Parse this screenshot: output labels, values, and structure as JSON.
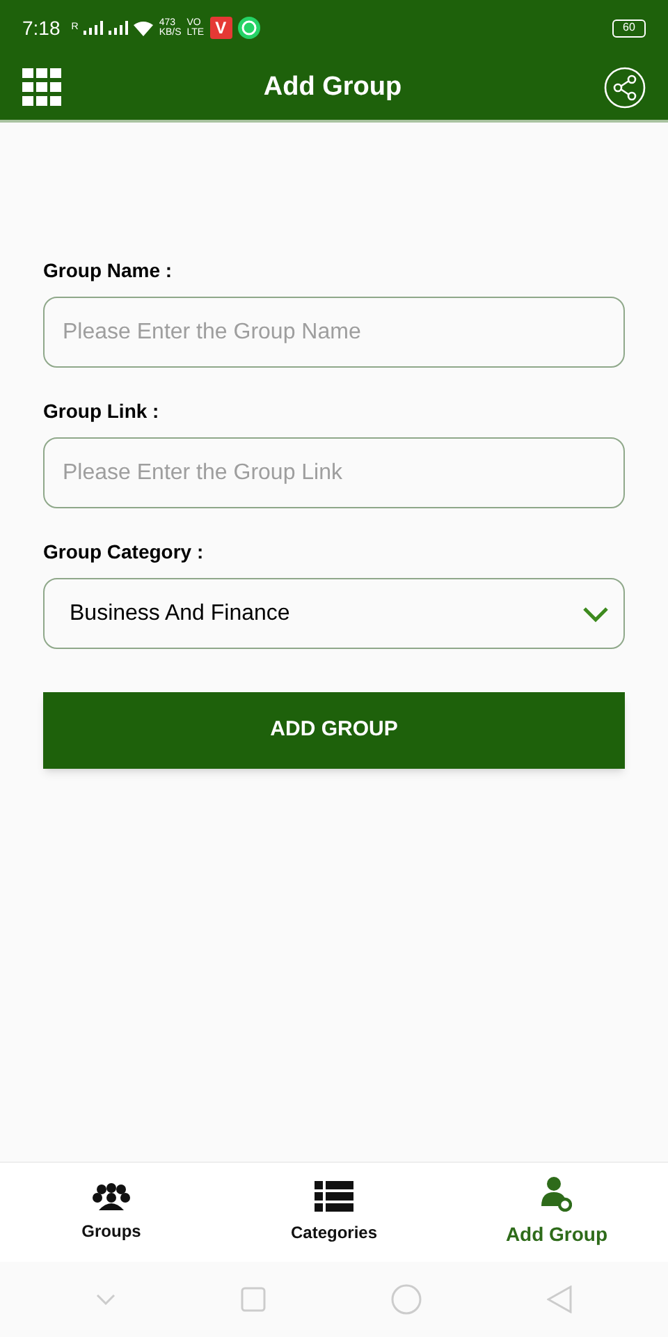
{
  "status_bar": {
    "time": "7:18",
    "roaming": "R",
    "speed": "473",
    "speed_unit": "KB/S",
    "volte": "VO",
    "volte_sub": "LTE",
    "app_badge": "V",
    "battery": "60"
  },
  "app_bar": {
    "title": "Add Group"
  },
  "form": {
    "fields": [
      {
        "kind": "input",
        "label": "Group Name :",
        "placeholder": "Please Enter the Group Name"
      },
      {
        "kind": "input",
        "label": "Group Link :",
        "placeholder": "Please Enter the Group Link"
      },
      {
        "kind": "select",
        "label": "Group Category :",
        "value": "Business And Finance"
      }
    ],
    "submit": "ADD GROUP"
  },
  "bottom_nav": [
    {
      "kind": "groups",
      "label": "Groups",
      "selected": false
    },
    {
      "kind": "categories",
      "label": "Categories",
      "selected": false
    },
    {
      "kind": "add",
      "label": "Add Group",
      "selected": true
    }
  ]
}
